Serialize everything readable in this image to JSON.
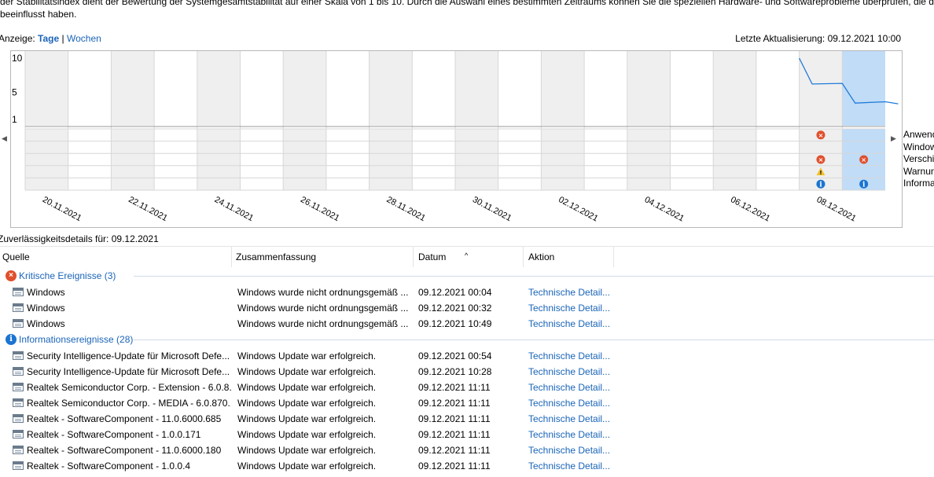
{
  "intro": {
    "line1": "der Stabilitätsindex dient der Bewertung der Systemgesamtstabilität auf einer Skala von 1 bis 10. Durch die Auswahl eines bestimmten Zeitraums können Sie die speziellen Hardware- und Softwareprobleme überprüfen, die das System",
    "line2": "beeinflusst haben."
  },
  "view": {
    "label": "Anzeige:",
    "days": "Tage",
    "sep": "|",
    "weeks": "Wochen",
    "last_update": "Letzte Aktualisierung: 09.12.2021 10:00"
  },
  "chart_data": {
    "type": "line",
    "y_ticks": [
      "10",
      "5",
      "1"
    ],
    "ylim": [
      1,
      10
    ],
    "x_labels": [
      "20.11.2021",
      "22.11.2021",
      "24.11.2021",
      "26.11.2021",
      "28.11.2021",
      "30.11.2021",
      "02.12.2021",
      "04.12.2021",
      "06.12.2021",
      "08.12.2021"
    ],
    "series": [
      {
        "values": [
          {
            "day": "08.12.2021",
            "y": 10
          },
          {
            "day": "08.12.2021",
            "y": 6.2
          },
          {
            "day": "09.12.2021",
            "y": 6.3
          },
          {
            "day": "09.12.2021",
            "y": 3.4
          },
          {
            "day": "10.12.2021",
            "y": 3.6
          },
          {
            "day": "10.12.2021",
            "y": 3.3
          }
        ]
      }
    ],
    "row_labels": [
      "Anwend",
      "Window",
      "Verschie",
      "Warnun",
      "Informa"
    ],
    "markers": [
      {
        "day": "08.12.2021",
        "row": 0,
        "kind": "error"
      },
      {
        "day": "08.12.2021",
        "row": 2,
        "kind": "error"
      },
      {
        "day": "08.12.2021",
        "row": 3,
        "kind": "warning"
      },
      {
        "day": "08.12.2021",
        "row": 4,
        "kind": "info"
      },
      {
        "day": "09.12.2021",
        "row": 2,
        "kind": "error"
      },
      {
        "day": "09.12.2021",
        "row": 4,
        "kind": "info"
      }
    ],
    "selected_day": "09.12.2021",
    "colors": {
      "line": "#1f7ad8",
      "selected": "#c0dcf7",
      "shade": "#efefef",
      "grid": "#d7d7d7",
      "error": "#e0502d",
      "warning": "#f2c12e",
      "info": "#1b74d1"
    }
  },
  "details": {
    "title": "Zuverlässigkeitsdetails für: 09.12.2021"
  },
  "table": {
    "columns": [
      "Quelle",
      "Zusammenfassung",
      "Datum",
      "Aktion"
    ],
    "groups": [
      {
        "title": "Kritische Ereignisse (3)",
        "icon": "error-icon",
        "rows": [
          {
            "source": "Windows",
            "summary": "Windows wurde nicht ordnungsgemäß ...",
            "date": "09.12.2021 00:04",
            "action": "Technische Detail..."
          },
          {
            "source": "Windows",
            "summary": "Windows wurde nicht ordnungsgemäß ...",
            "date": "09.12.2021 00:32",
            "action": "Technische Detail..."
          },
          {
            "source": "Windows",
            "summary": "Windows wurde nicht ordnungsgemäß ...",
            "date": "09.12.2021 10:49",
            "action": "Technische Detail..."
          }
        ]
      },
      {
        "title": "Informationsereignisse (28)",
        "icon": "info-icon",
        "rows": [
          {
            "source": "Security Intelligence-Update für Microsoft Defe...",
            "summary": "Windows Update war erfolgreich.",
            "date": "09.12.2021 00:54",
            "action": "Technische Detail..."
          },
          {
            "source": "Security Intelligence-Update für Microsoft Defe...",
            "summary": "Windows Update war erfolgreich.",
            "date": "09.12.2021 10:28",
            "action": "Technische Detail..."
          },
          {
            "source": "Realtek Semiconductor Corp. - Extension - 6.0.8...",
            "summary": "Windows Update war erfolgreich.",
            "date": "09.12.2021 11:11",
            "action": "Technische Detail..."
          },
          {
            "source": "Realtek Semiconductor Corp. - MEDIA - 6.0.870...",
            "summary": "Windows Update war erfolgreich.",
            "date": "09.12.2021 11:11",
            "action": "Technische Detail..."
          },
          {
            "source": "Realtek - SoftwareComponent - 11.0.6000.685",
            "summary": "Windows Update war erfolgreich.",
            "date": "09.12.2021 11:11",
            "action": "Technische Detail..."
          },
          {
            "source": "Realtek - SoftwareComponent - 1.0.0.171",
            "summary": "Windows Update war erfolgreich.",
            "date": "09.12.2021 11:11",
            "action": "Technische Detail..."
          },
          {
            "source": "Realtek - SoftwareComponent - 11.0.6000.180",
            "summary": "Windows Update war erfolgreich.",
            "date": "09.12.2021 11:11",
            "action": "Technische Detail..."
          },
          {
            "source": "Realtek - SoftwareComponent - 1.0.0.4",
            "summary": "Windows Update war erfolgreich.",
            "date": "09.12.2021 11:11",
            "action": "Technische Detail..."
          }
        ]
      }
    ]
  }
}
